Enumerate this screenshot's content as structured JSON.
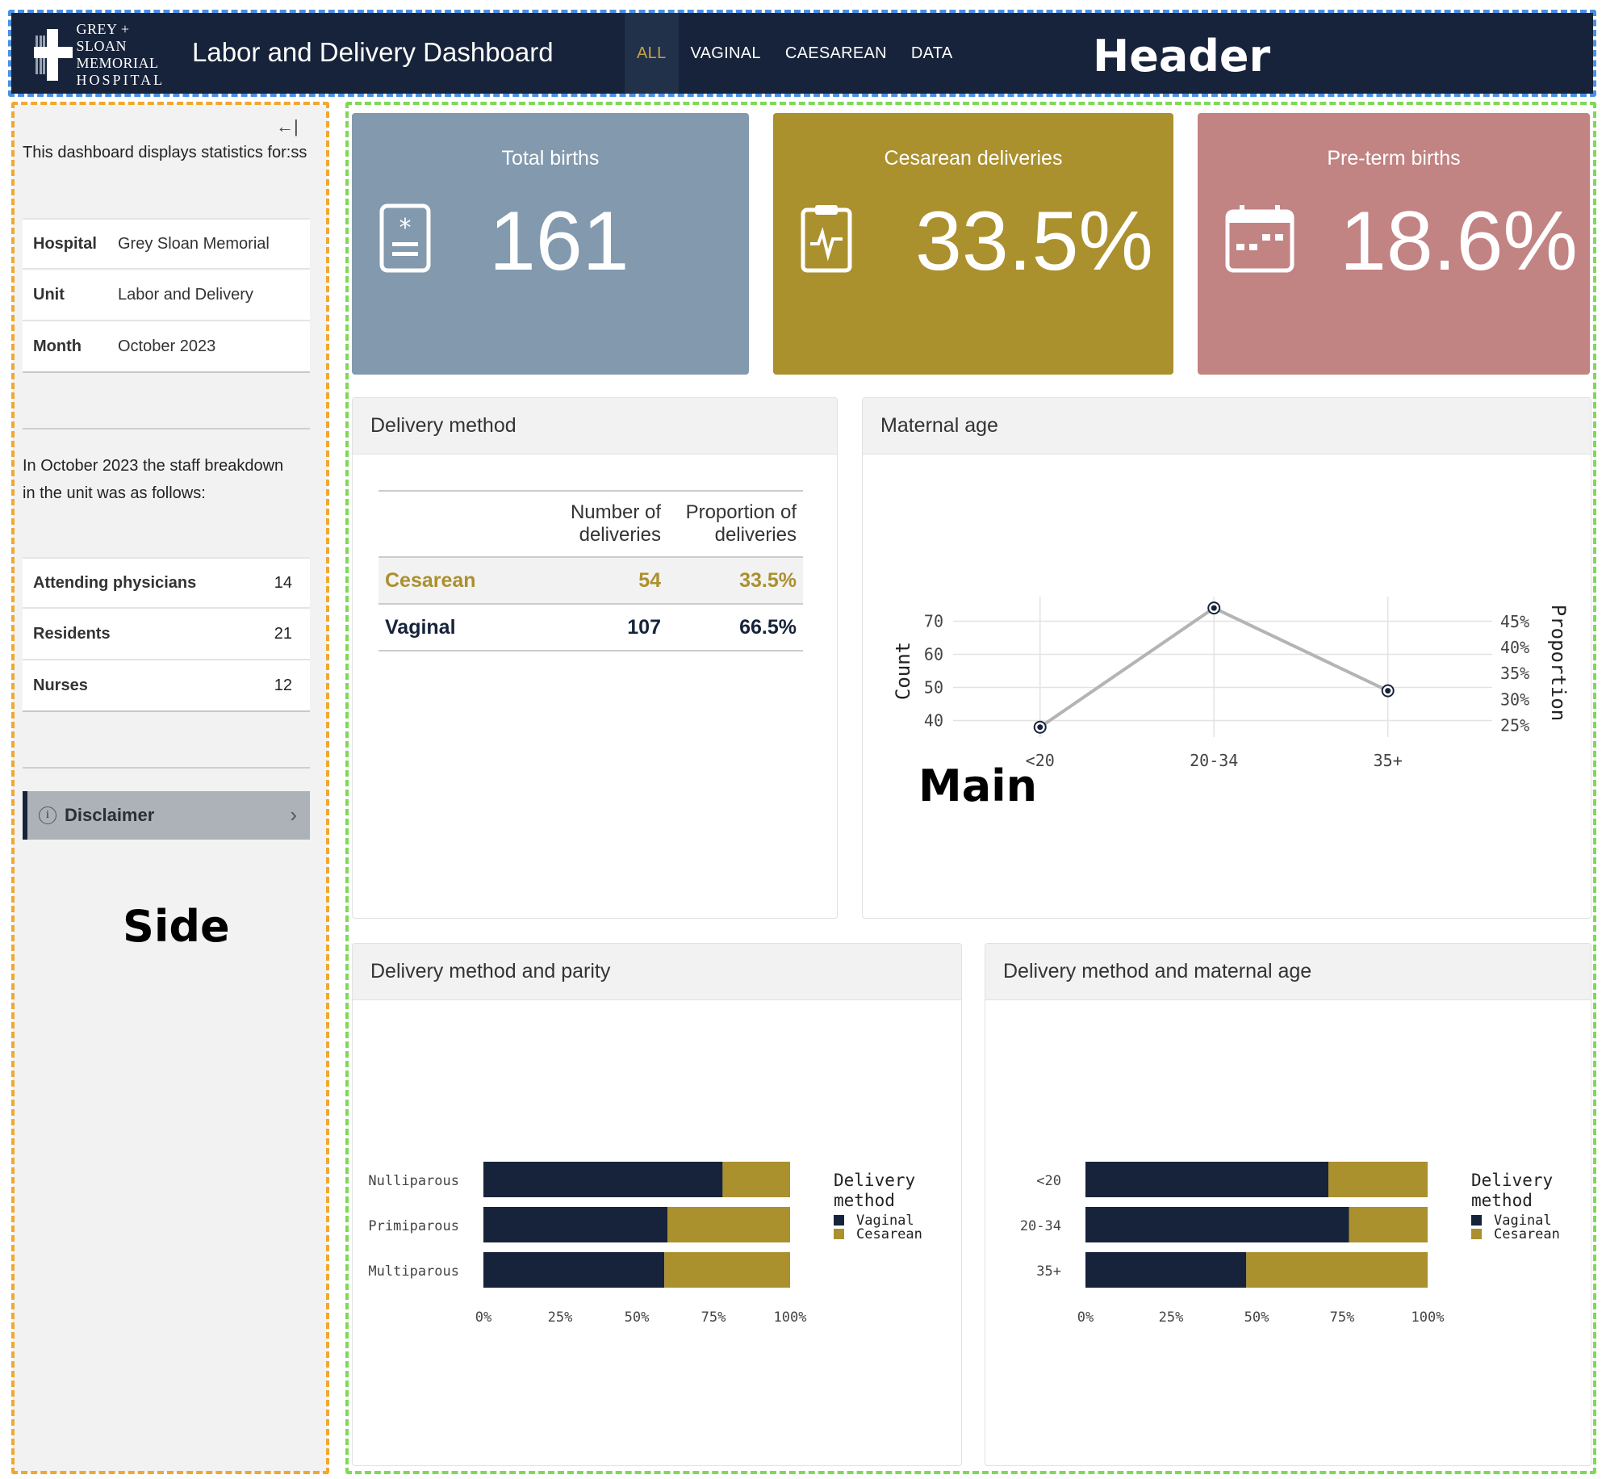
{
  "header": {
    "logo_lines": [
      "GREY + SLOAN",
      "MEMORIAL",
      "HOSPITAL"
    ],
    "title": "Labor and Delivery Dashboard",
    "tabs": [
      {
        "label": "ALL",
        "active": true
      },
      {
        "label": "VAGINAL",
        "active": false
      },
      {
        "label": "CAESAREAN",
        "active": false
      },
      {
        "label": "DATA",
        "active": false
      }
    ]
  },
  "annotations": {
    "header": "Header",
    "side": "Side",
    "main": "Main"
  },
  "sidebar": {
    "collapse_icon": "←|",
    "intro": "This dashboard displays statistics for:ss",
    "info": [
      {
        "key": "Hospital",
        "value": "Grey Sloan Memorial"
      },
      {
        "key": "Unit",
        "value": "Labor and Delivery"
      },
      {
        "key": "Month",
        "value": "October 2023"
      }
    ],
    "staff_intro": "In October 2023 the staff breakdown in the unit was as follows:",
    "staff": [
      {
        "role": "Attending physicians",
        "count": "14"
      },
      {
        "role": "Residents",
        "count": "21"
      },
      {
        "role": "Nurses",
        "count": "12"
      }
    ],
    "disclaimer": "Disclaimer"
  },
  "value_boxes": [
    {
      "title": "Total births",
      "value": "161",
      "color": "#8299ae",
      "icon": "medical-record-icon"
    },
    {
      "title": "Cesarean deliveries",
      "value": "33.5%",
      "color": "#ab902e",
      "icon": "clipboard-pulse-icon"
    },
    {
      "title": "Pre-term births",
      "value": "18.6%",
      "color": "#c28383",
      "icon": "calendar-icon"
    }
  ],
  "delivery_method": {
    "title": "Delivery method",
    "headers": [
      "",
      "Number of deliveries",
      "Proportion of deliveries"
    ],
    "rows": [
      {
        "method": "Cesarean",
        "count": "54",
        "proportion": "33.5%",
        "color": "#ab902e"
      },
      {
        "method": "Vaginal",
        "count": "107",
        "proportion": "66.5%",
        "color": "#16233a"
      }
    ]
  },
  "maternal_age": {
    "title": "Maternal age"
  },
  "parity_card": {
    "title": "Delivery method and parity"
  },
  "age_card": {
    "title": "Delivery method and maternal age"
  },
  "colors": {
    "navy": "#16233a",
    "gold": "#ab902e",
    "grey_line": "#b4b4b4"
  },
  "chart_data": [
    {
      "type": "line",
      "x": [
        "<20",
        "20-34",
        "35+"
      ],
      "y": [
        38,
        74,
        49
      ],
      "ylabel": "Count",
      "y2label": "Proportion",
      "yticks": [
        "40",
        "50",
        "60",
        "70"
      ],
      "y2ticks": [
        "25%",
        "30%",
        "35%",
        "40%",
        "45%"
      ],
      "ylim": [
        35,
        75
      ],
      "grid": true
    },
    {
      "type": "bar",
      "orientation": "horizontal-stacked-percent",
      "categories": [
        "Nulliparous",
        "Primiparous",
        "Multiparous"
      ],
      "series": [
        {
          "name": "Vaginal",
          "values": [
            0.78,
            0.6,
            0.59
          ],
          "color": "#16233a"
        },
        {
          "name": "Cesarean",
          "values": [
            0.22,
            0.4,
            0.41
          ],
          "color": "#ab902e"
        }
      ],
      "xticks": [
        "0%",
        "25%",
        "50%",
        "75%",
        "100%"
      ],
      "legend_title": "Delivery method",
      "legend_position": "right"
    },
    {
      "type": "bar",
      "orientation": "horizontal-stacked-percent",
      "categories": [
        "<20",
        "20-34",
        "35+"
      ],
      "series": [
        {
          "name": "Vaginal",
          "values": [
            0.71,
            0.77,
            0.47
          ],
          "color": "#16233a"
        },
        {
          "name": "Cesarean",
          "values": [
            0.29,
            0.23,
            0.53
          ],
          "color": "#ab902e"
        }
      ],
      "xticks": [
        "0%",
        "25%",
        "50%",
        "75%",
        "100%"
      ],
      "legend_title": "Delivery method",
      "legend_position": "right"
    }
  ]
}
